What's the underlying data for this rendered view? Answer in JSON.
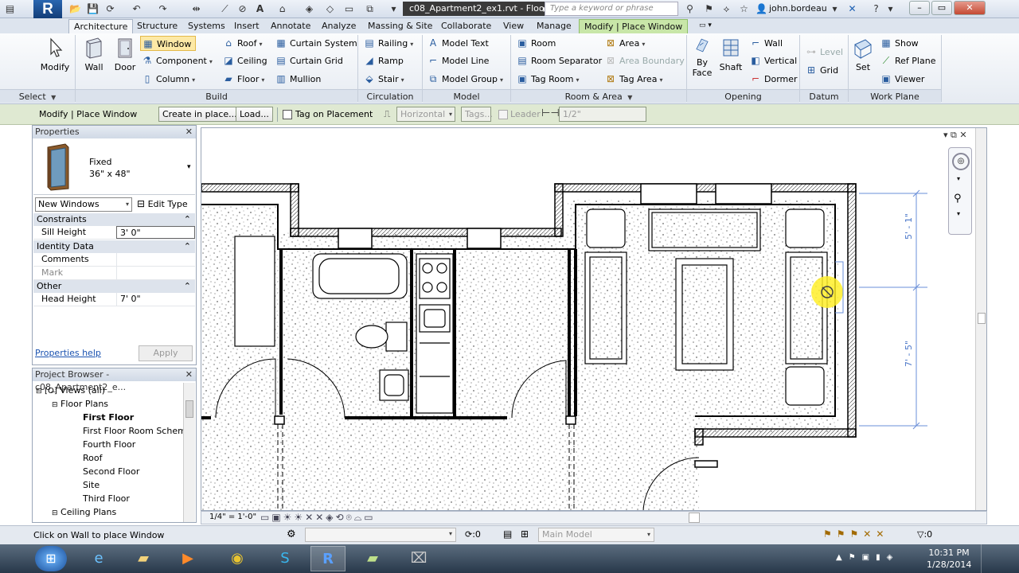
{
  "titlebar": {
    "doc_title": "c08_Apartment2_ex1.rvt - Floo...",
    "search_placeholder": "Type a keyword or phrase",
    "user": "john.bordeau"
  },
  "tabs": [
    "Architecture",
    "Structure",
    "Systems",
    "Insert",
    "Annotate",
    "Analyze",
    "Massing & Site",
    "Collaborate",
    "View",
    "Manage",
    "Modify | Place Window"
  ],
  "ribbon": {
    "select": {
      "modify": "Modify",
      "panel": "Select"
    },
    "build": {
      "panel": "Build",
      "wall": "Wall",
      "door": "Door",
      "window": "Window",
      "component": "Component",
      "column": "Column",
      "roof": "Roof",
      "ceiling": "Ceiling",
      "floor": "Floor",
      "curtain_system": "Curtain System",
      "curtain_grid": "Curtain Grid",
      "mullion": "Mullion"
    },
    "circulation": {
      "panel": "Circulation",
      "railing": "Railing",
      "ramp": "Ramp",
      "stair": "Stair"
    },
    "model": {
      "panel": "Model",
      "model_text": "Model Text",
      "model_line": "Model Line",
      "model_group": "Model Group"
    },
    "room_area": {
      "panel": "Room & Area",
      "room": "Room",
      "room_separator": "Room Separator",
      "tag_room": "Tag Room",
      "area": "Area",
      "area_boundary": "Area Boundary",
      "tag_area": "Tag Area"
    },
    "opening": {
      "panel": "Opening",
      "by_face": "By Face",
      "by_face_2": "Face",
      "by_face_1": "By",
      "shaft": "Shaft",
      "wall": "Wall",
      "vertical": "Vertical",
      "dormer": "Dormer"
    },
    "datum": {
      "panel": "Datum",
      "level": "Level",
      "grid": "Grid"
    },
    "work_plane": {
      "panel": "Work Plane",
      "set": "Set",
      "show": "Show",
      "ref_plane": "Ref Plane",
      "viewer": "Viewer"
    }
  },
  "options_bar": {
    "context": "Modify | Place Window",
    "create_in_place": "Create in place...",
    "load": "Load...",
    "tag_on_placement": "Tag on Placement",
    "orientation": "Horizontal",
    "tags": "Tags...",
    "leader": "Leader",
    "leader_length": "1/2\""
  },
  "properties": {
    "title": "Properties",
    "type_name": "Fixed",
    "type_size": "36\" x 48\"",
    "instance_filter": "New Windows",
    "edit_type": "Edit Type",
    "sections": {
      "constraints": "Constraints",
      "identity": "Identity Data",
      "other": "Other"
    },
    "rows": {
      "sill_height_label": "Sill Height",
      "sill_height": "3' 0\"",
      "comments_label": "Comments",
      "comments": "",
      "mark_label": "Mark",
      "mark": "",
      "head_height_label": "Head Height",
      "head_height": "7' 0\""
    },
    "help": "Properties help",
    "apply": "Apply"
  },
  "browser": {
    "title": "Project Browser - c08_Apartment2_e...",
    "root": "Views (all)",
    "floor_plans": "Floor Plans",
    "items": [
      "First Floor",
      "First Floor Room Scheme",
      "Fourth Floor",
      "Roof",
      "Second Floor",
      "Site",
      "Third Floor"
    ],
    "ceiling_plans": "Ceiling Plans"
  },
  "view": {
    "scale": "1/4\" = 1'-0\"",
    "dim_upper": "5' - 1\"",
    "dim_lower": "7' - 5\""
  },
  "status": {
    "message": "Click on Wall to place Window",
    "count": ":0",
    "model": "Main Model",
    "filter_count": ":0"
  },
  "taskbar": {
    "time": "10:31 PM",
    "date": "1/28/2014"
  }
}
